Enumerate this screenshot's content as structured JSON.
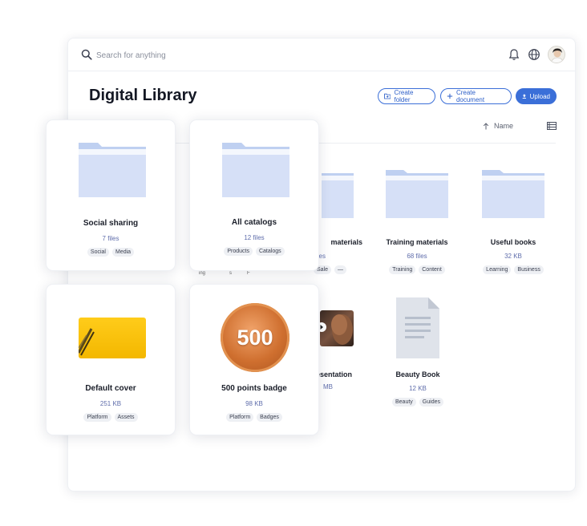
{
  "header": {
    "search_placeholder": "Search for anything",
    "icons": [
      "search-icon",
      "bell-icon",
      "globe-icon",
      "avatar"
    ]
  },
  "page": {
    "title": "Digital Library",
    "create_folder_label": "Create folder",
    "create_document_label": "Create document",
    "upload_label": "Upload",
    "sort_label": "Name",
    "accent_color": "#3b6fd8"
  },
  "background_items": [
    {
      "name": "materials",
      "meta": "files",
      "tags": [
        "Sale",
        "—"
      ]
    },
    {
      "name": "Training materials",
      "meta": "68 files",
      "tags": [
        "Training",
        "Content"
      ]
    },
    {
      "name": "Useful books",
      "meta": "32 KB",
      "tags": [
        "Learning",
        "Business"
      ]
    },
    {
      "name": "esentation",
      "meta": "MB",
      "tags": []
    },
    {
      "name": "Beauty Book",
      "meta": "12 KB",
      "tags": [
        "Beauty",
        "Guides"
      ]
    }
  ],
  "hidden_row_fragments": [
    "ing",
    "s",
    "F"
  ],
  "overlay_cards": [
    {
      "name": "Social sharing",
      "meta": "7 files",
      "tags": [
        "Social",
        "Media"
      ]
    },
    {
      "name": "All catalogs",
      "meta": "12 files",
      "tags": [
        "Products",
        "Catalogs"
      ]
    },
    {
      "name": "Default cover",
      "meta": "251 KB",
      "tags": [
        "Platform",
        "Assets"
      ]
    },
    {
      "name": "500 points badge",
      "meta": "98 KB",
      "tags": [
        "Platform",
        "Badges"
      ],
      "badge_text": "500"
    }
  ]
}
